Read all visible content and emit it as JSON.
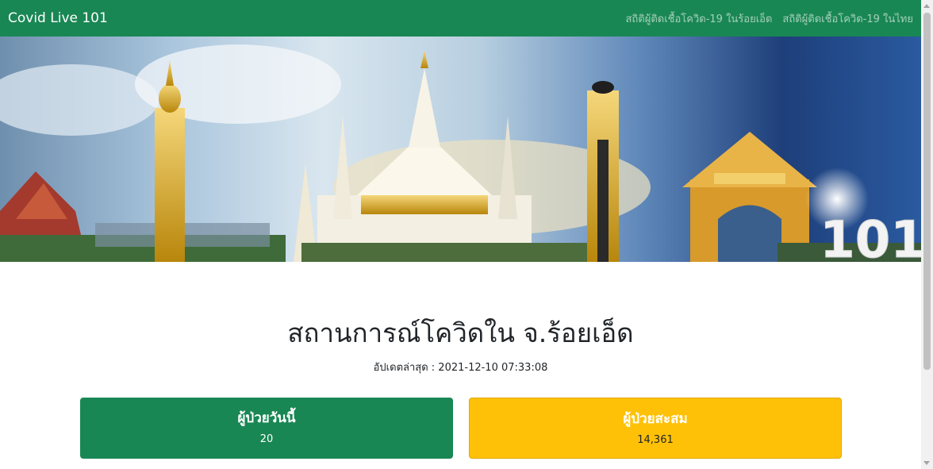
{
  "navbar": {
    "brand": "Covid Live 101",
    "links": [
      {
        "label": "สถิติผู้ติดเชื้อโควิด-19 ในร้อยเอ็ด"
      },
      {
        "label": "สถิติผู้ติดเชื้อโควิด-19 ในไทย"
      }
    ]
  },
  "banner": {
    "logo_text": "101"
  },
  "main": {
    "title": "สถานการณ์โควิดใน จ.ร้อยเอ็ด",
    "updated": "อัปเดตล่าสุด : 2021-12-10 07:33:08"
  },
  "cards": {
    "today": {
      "title": "ผู้ป่วยวันนี้",
      "value": "20",
      "color": "#198754"
    },
    "total": {
      "title": "ผู้ป่วยสะสม",
      "value": "14,361",
      "color": "#ffc107"
    }
  },
  "colors": {
    "navbar": "#198754",
    "accent_gold": "#d4a017"
  }
}
